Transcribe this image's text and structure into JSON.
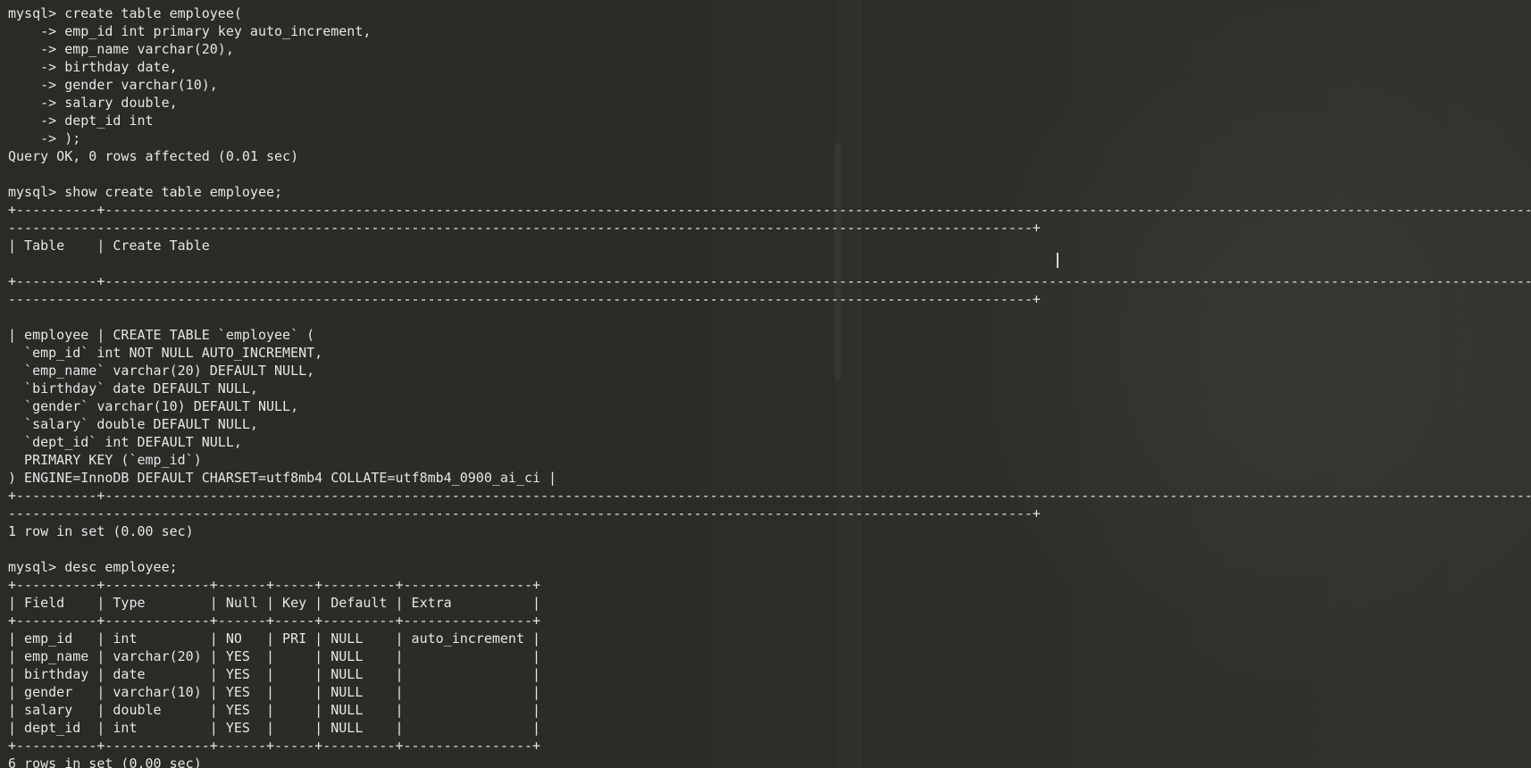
{
  "prompt": "mysql>",
  "terminal": {
    "lines": [
      "mysql> create table employee(",
      "    -> emp_id int primary key auto_increment,",
      "    -> emp_name varchar(20),",
      "    -> birthday date,",
      "    -> gender varchar(10),",
      "    -> salary double,",
      "    -> dept_id int",
      "    -> );",
      "Query OK, 0 rows affected (0.01 sec)",
      "",
      "mysql> show create table employee;",
      "+----------+-------------------------------------------------------------------------------------------------------------------------------------------------------------------------------------------------------------------------------------------------------------------------------------------------------------------------------------------------------------------------------+",
      "-------------------------------------------------------------------------------------------------------------------------------+",
      "| Table    | Create Table",
      "",
      "+----------+-------------------------------------------------------------------------------------------------------------------------------------------------------------------------------------------------------------------------------------------------------------------------------------------------------------------------------------------------------------------------------+",
      "-------------------------------------------------------------------------------------------------------------------------------+",
      "",
      "| employee | CREATE TABLE `employee` (",
      "  `emp_id` int NOT NULL AUTO_INCREMENT,",
      "  `emp_name` varchar(20) DEFAULT NULL,",
      "  `birthday` date DEFAULT NULL,",
      "  `gender` varchar(10) DEFAULT NULL,",
      "  `salary` double DEFAULT NULL,",
      "  `dept_id` int DEFAULT NULL,",
      "  PRIMARY KEY (`emp_id`)",
      ") ENGINE=InnoDB DEFAULT CHARSET=utf8mb4 COLLATE=utf8mb4_0900_ai_ci |",
      "+----------+-------------------------------------------------------------------------------------------------------------------------------------------------------------------------------------------------------------------------------------------------------------------------------------------------------------------------------------------------------------------------------+",
      "-------------------------------------------------------------------------------------------------------------------------------+",
      "1 row in set (0.00 sec)",
      "",
      "mysql> desc employee;",
      "+----------+-------------+------+-----+---------+----------------+",
      "| Field    | Type        | Null | Key | Default | Extra          |",
      "+----------+-------------+------+-----+---------+----------------+",
      "| emp_id   | int         | NO   | PRI | NULL    | auto_increment |",
      "| emp_name | varchar(20) | YES  |     | NULL    |                |",
      "| birthday | date        | YES  |     | NULL    |                |",
      "| gender   | varchar(10) | YES  |     | NULL    |                |",
      "| salary   | double      | YES  |     | NULL    |                |",
      "| dept_id  | int         | YES  |     | NULL    |                |",
      "+----------+-------------+------+-----+---------+----------------+",
      "6 rows in set (0.00 sec)"
    ]
  },
  "colors": {
    "background": "#2a2c27",
    "text": "#e6e6e6",
    "cursor": "#d8d8d8"
  }
}
